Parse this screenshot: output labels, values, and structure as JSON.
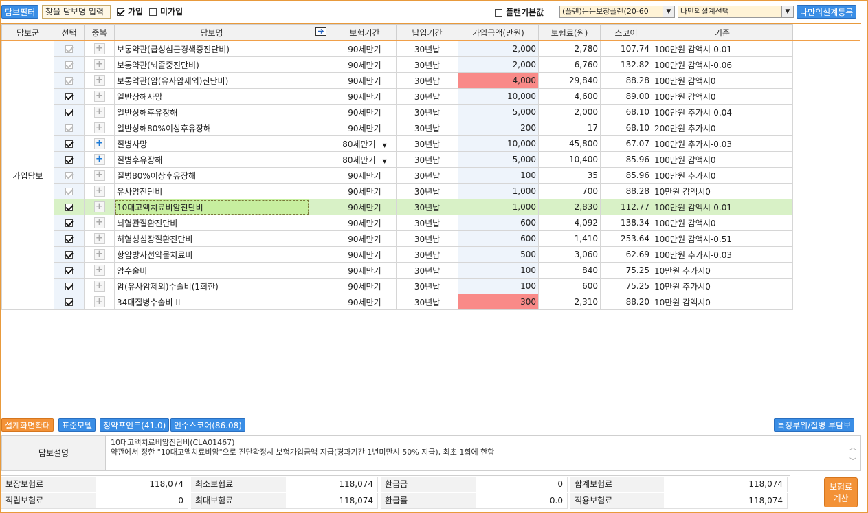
{
  "toolbar": {
    "filter_button": "담보필터",
    "search_placeholder": "찾을 담보명 입력",
    "joined_label": "가입",
    "not_joined_label": "미가입",
    "plan_default_label": "플랜기본값",
    "plan_select": "(플랜)든든보장플랜(20-60",
    "design_select": "나만의설계선택",
    "register_button": "나만의설계등록"
  },
  "table": {
    "headers": {
      "group": "담보군",
      "select": "선택",
      "dup": "중복",
      "name": "담보명",
      "period": "보험기간",
      "pay": "납입기간",
      "amount": "가입금액(만원)",
      "premium": "보험료(원)",
      "score": "스코어",
      "basis": "기준"
    },
    "group_label": "가입담보",
    "rows": [
      {
        "name": "보통약관(급성심근경색증진단비)",
        "period": "90세만기",
        "pay": "30년납",
        "amount": "2,000",
        "premium": "2,780",
        "score": "107.74",
        "basis": "100만원 감액시-0.01"
      },
      {
        "name": "보통약관(뇌졸중진단비)",
        "period": "90세만기",
        "pay": "30년납",
        "amount": "2,000",
        "premium": "6,760",
        "score": "132.82",
        "basis": "100만원 감액시-0.06"
      },
      {
        "name": "보통약관(암(유사암제외)진단비)",
        "period": "90세만기",
        "pay": "30년납",
        "amount": "4,000",
        "premium": "29,840",
        "score": "88.28",
        "basis": "100만원 감액시0"
      },
      {
        "name": "일반상해사망",
        "period": "90세만기",
        "pay": "30년납",
        "amount": "10,000",
        "premium": "4,600",
        "score": "89.00",
        "basis": "100만원 감액시0"
      },
      {
        "name": "일반상해후유장해",
        "period": "90세만기",
        "pay": "30년납",
        "amount": "5,000",
        "premium": "2,000",
        "score": "68.10",
        "basis": "100만원 추가시-0.04"
      },
      {
        "name": "일반상해80%이상후유장해",
        "period": "90세만기",
        "pay": "30년납",
        "amount": "200",
        "premium": "17",
        "score": "68.10",
        "basis": "200만원 추가시0"
      },
      {
        "name": "질병사망",
        "period": "80세만기",
        "pay": "30년납",
        "amount": "10,000",
        "premium": "45,800",
        "score": "67.07",
        "basis": "100만원 추가시-0.03"
      },
      {
        "name": "질병후유장해",
        "period": "80세만기",
        "pay": "30년납",
        "amount": "5,000",
        "premium": "10,400",
        "score": "85.96",
        "basis": "100만원 감액시0"
      },
      {
        "name": "질병80%이상후유장해",
        "period": "90세만기",
        "pay": "30년납",
        "amount": "100",
        "premium": "35",
        "score": "85.96",
        "basis": "100만원 추가시0"
      },
      {
        "name": "유사암진단비",
        "period": "90세만기",
        "pay": "30년납",
        "amount": "1,000",
        "premium": "700",
        "score": "88.28",
        "basis": "10만원 감액시0"
      },
      {
        "name": "10대고액치료비암진단비",
        "period": "90세만기",
        "pay": "30년납",
        "amount": "1,000",
        "premium": "2,830",
        "score": "112.77",
        "basis": "100만원 감액시-0.01"
      },
      {
        "name": "뇌혈관질환진단비",
        "period": "90세만기",
        "pay": "30년납",
        "amount": "600",
        "premium": "4,092",
        "score": "138.34",
        "basis": "100만원 감액시0"
      },
      {
        "name": "허혈성심장질환진단비",
        "period": "90세만기",
        "pay": "30년납",
        "amount": "600",
        "premium": "1,410",
        "score": "253.64",
        "basis": "100만원 감액시-0.51"
      },
      {
        "name": "항암방사선약물치료비",
        "period": "90세만기",
        "pay": "30년납",
        "amount": "500",
        "premium": "3,060",
        "score": "62.69",
        "basis": "100만원 추가시-0.03"
      },
      {
        "name": "암수술비",
        "period": "90세만기",
        "pay": "30년납",
        "amount": "100",
        "premium": "840",
        "score": "75.25",
        "basis": "10만원 추가시0"
      },
      {
        "name": "암(유사암제외)수술비(1회한)",
        "period": "90세만기",
        "pay": "30년납",
        "amount": "100",
        "premium": "600",
        "score": "75.25",
        "basis": "10만원 추가시0"
      },
      {
        "name": "34대질병수술비 II",
        "period": "90세만기",
        "pay": "30년납",
        "amount": "300",
        "premium": "2,310",
        "score": "88.20",
        "basis": "10만원 감액시0"
      }
    ]
  },
  "bottom_buttons": {
    "enlarge": "설계화면확대",
    "standard": "표준모델",
    "subscription": "청약포인트(41.0)",
    "underwriting": "인수스코어(86.08)",
    "special": "특정부위/질병 부담보"
  },
  "description": {
    "label": "담보설명",
    "line1": "10대고액치료비암진단비(CLA01467)",
    "line2": "약관에서 정한 \"10대고액치료비암\"으로 진단확정시 보험가입금액 지급(경과기간 1년미만시 50% 지급), 최초 1회에 한함"
  },
  "summary": {
    "coverage_premium_label": "보장보험료",
    "coverage_premium": "118,074",
    "min_premium_label": "최소보험료",
    "min_premium": "118,074",
    "refund_label": "환급금",
    "refund": "0",
    "total_premium_label": "합계보험료",
    "total_premium": "118,074",
    "savings_premium_label": "적립보험료",
    "savings_premium": "0",
    "max_premium_label": "최대보험료",
    "max_premium": "118,074",
    "refund_rate_label": "환급률",
    "refund_rate": "0.0",
    "applied_premium_label": "적용보험료",
    "applied_premium": "118,074",
    "calc_button_line1": "보험료",
    "calc_button_line2": "계산"
  }
}
